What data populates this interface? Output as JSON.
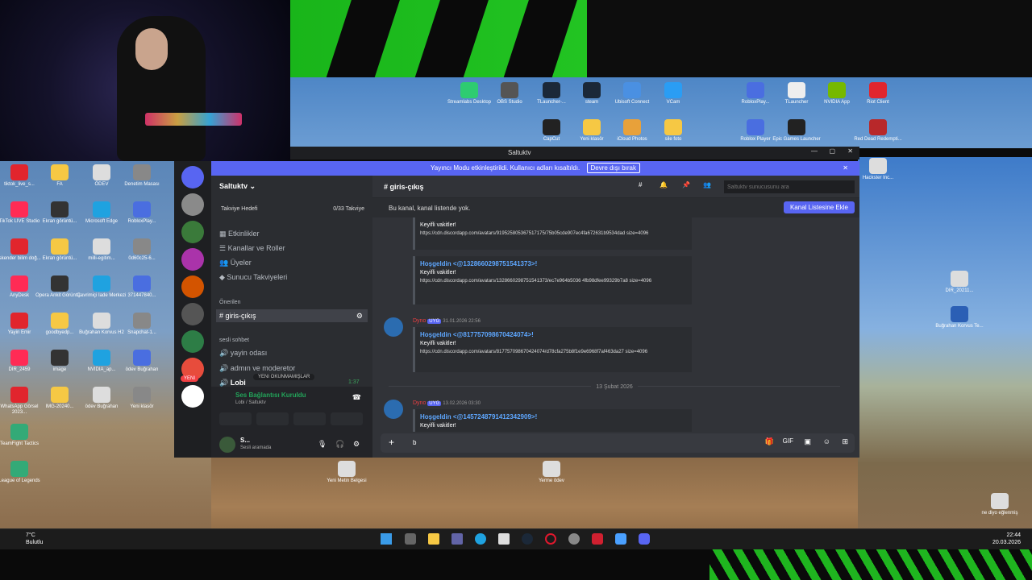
{
  "desktop_top_icons": [
    "Streamlabs Desktop",
    "OBS Studio",
    "TLauncher-...",
    "steam",
    "Ubisoft Connect",
    "VCam",
    "RobloxPlay...",
    "TLauncher",
    "NVIDIA App",
    "Riot Client",
    "CapCut",
    "Yeni klasör",
    "iCloud Photos",
    "sile foto",
    "Roblox Player",
    "Epic Games Launcher",
    "Red Dead Redempti..."
  ],
  "desktop_left_icons": [
    "tiktok_live_s...",
    "FA",
    "ÖDEV",
    "Denetim Masası",
    "TikTok LIVE Studio",
    "Ekran görüntü...",
    "Microsoft Edge",
    "RobloxPlay...",
    "iskender bilim doğ...",
    "Ekran görüntü...",
    "milli-egitim...",
    "0d60c25-6...",
    "AnyDesk",
    "Opera Ankit Görüntü...",
    "Çevrimiçi Iade Merkezi",
    "371447840...",
    "Yayin Emir",
    "goodbyedp...",
    "Buğrahan Korvus H2",
    "Snapchat-1...",
    "DIR_2459",
    "image",
    "NVIDIA_ap...",
    "ödev Buğrahan",
    "WhatsApp Görsel 2023...",
    "IMG-20240...",
    "ödev Buğrahan",
    "Yeni klasör",
    "TeamFight Tactics",
    "League of Legends"
  ],
  "desktop_right_icons": [
    "Hackster Inc...",
    "DIR_20211...",
    "Buğrahan Korvus Te...",
    "Yeni Metin Belgesi",
    "Yerme ödev",
    "ne diyo eğlenmiş"
  ],
  "window": {
    "title": "Saltuktv"
  },
  "banner": {
    "text": "Yayıncı Modu etkinleştirildi. Kullanıcı adları kısaltıldı.",
    "button": "Devre dışı bırak"
  },
  "server": {
    "name": "Saltuktv",
    "boost_label": "Takviye Hedefi",
    "boost_value": "0/33 Takviye",
    "menu": [
      "Etkinlikler",
      "Kanallar ve Roller",
      "Üyeler",
      "Sunucu Takviyeleri"
    ],
    "suggested_label": "Önerilen",
    "active_channel": "giris-çıkış",
    "voice_category": "sesli sohbet",
    "voice_channels": [
      "yayin odası",
      "admın ve moderetor",
      "Lobi"
    ],
    "lobi_time": "1:37",
    "unread_pill": "YENI OKUNMAMIŞLAR",
    "voice_status": "Ses Bağlantısı Kuruldu",
    "voice_sub": "Lobi / Saltuktv",
    "user_name": "S...",
    "user_status": "Sesli aramada",
    "new_badge": "YENI"
  },
  "chat": {
    "channel": "giris-çıkış",
    "search_placeholder": "Saltuktv sunucusunu ara",
    "notice": "Bu kanal, kanal listende yok.",
    "add_button": "Kanal Listesine Ekle",
    "messages": [
      {
        "author": "",
        "tag": "",
        "time": "",
        "mention": "",
        "welcome": "Keyifli vakitler!",
        "link": "https://cdn.discordapp.com/avatars/919525805367517175/75b05cde907ec4fa672631b9534dad size=4096"
      },
      {
        "author": "",
        "tag": "",
        "time": "",
        "mention": "Hoşgeldin <@1328660298751541373>!",
        "welcome": "Keyifli vakitler!",
        "link": "https://cdn.discordapp.com/avatars/1328660298751541373/ec7e964b5036 4fb98dfee99329b7a8 size=4096"
      },
      {
        "author": "Dyno",
        "tag": "UYG",
        "time": "31.01.2026 22:56",
        "mention": "Hoşgeldin <@817757098670424074>!",
        "welcome": "Keyifli vakitler!",
        "link": "https://cdn.discordapp.com/avatars/817757098670424074/d78cfa275b8f1e9e6968f7af463da27 size=4096"
      },
      {
        "author": "Dyno",
        "tag": "UYG",
        "time": "13.02.2026 03:30",
        "mention": "Hoşgeldin <@1457248791412342909>!",
        "welcome": "Keyifli vakitler!",
        "link": ""
      }
    ],
    "date_divider": "13 Şubat 2026",
    "composer_value": "b"
  },
  "taskbar": {
    "weather_temp": "7°C",
    "weather_desc": "Bulutlu",
    "time": "22:44",
    "date": "20.03.2026"
  },
  "colors": {
    "blurple": "#5865f2",
    "green_bg": "#22c422",
    "discord_bg": "#313338"
  }
}
